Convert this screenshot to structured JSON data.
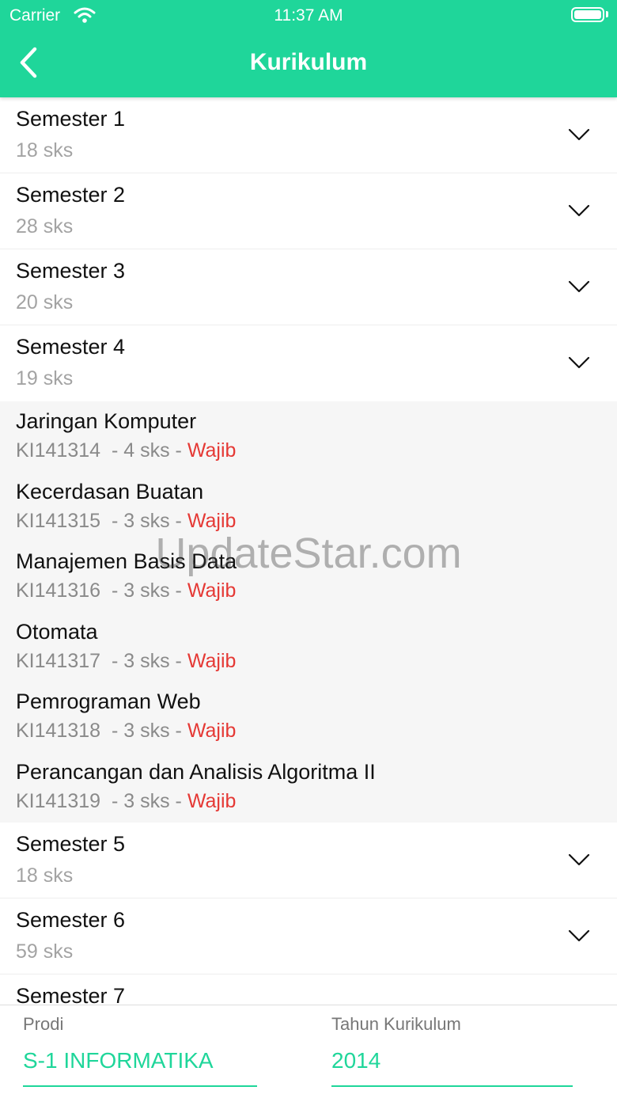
{
  "status_bar": {
    "carrier": "Carrier",
    "time": "11:37 AM"
  },
  "header": {
    "title": "Kurikulum"
  },
  "semesters_top": [
    {
      "title": "Semester 1",
      "sks": "18 sks"
    },
    {
      "title": "Semester 2",
      "sks": "28 sks"
    },
    {
      "title": "Semester 3",
      "sks": "20 sks"
    },
    {
      "title": "Semester 4",
      "sks": "19 sks"
    }
  ],
  "courses": [
    {
      "name": "Jaringan Komputer",
      "code": "KI141314",
      "sks": "4 sks",
      "type": "Wajib"
    },
    {
      "name": "Kecerdasan Buatan",
      "code": "KI141315",
      "sks": "3 sks",
      "type": "Wajib"
    },
    {
      "name": "Manajemen Basis Data",
      "code": "KI141316",
      "sks": "3 sks",
      "type": "Wajib"
    },
    {
      "name": "Otomata",
      "code": "KI141317",
      "sks": "3 sks",
      "type": "Wajib"
    },
    {
      "name": "Pemrograman Web",
      "code": "KI141318",
      "sks": "3 sks",
      "type": "Wajib"
    },
    {
      "name": "Perancangan dan Analisis Algoritma II",
      "code": "KI141319",
      "sks": "3 sks",
      "type": "Wajib"
    }
  ],
  "course_separator": "-",
  "semesters_bottom": [
    {
      "title": "Semester 5",
      "sks": "18 sks"
    },
    {
      "title": "Semester 6",
      "sks": "59 sks"
    },
    {
      "title": "Semester 7",
      "sks": ""
    }
  ],
  "footer": {
    "prodi_label": "Prodi",
    "prodi_value": "S-1 INFORMATIKA",
    "tahun_label": "Tahun Kurikulum",
    "tahun_value": "2014"
  },
  "watermark": "UpdateStar.com",
  "colors": {
    "accent": "#1fd69a",
    "required": "#e53935",
    "muted": "#a3a3a3"
  },
  "icons": {
    "back": "chevron-left-icon",
    "expand": "chevron-down-icon",
    "wifi": "wifi-icon",
    "battery": "battery-icon"
  }
}
